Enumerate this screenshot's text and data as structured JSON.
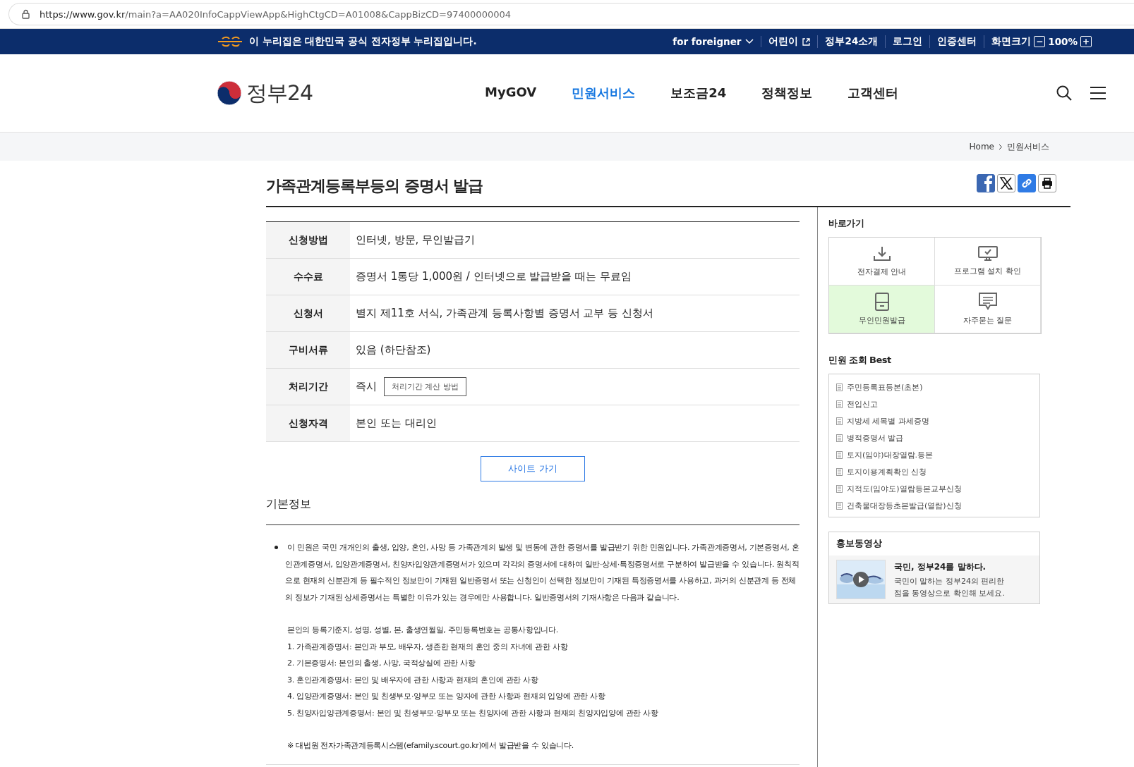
{
  "address_bar": {
    "url_host": "https://www.gov.kr",
    "url_path": "/main?a=AA020InfoCappViewApp&HighCtgCD=A01008&CappBizCD=97400000004"
  },
  "gov_banner": {
    "text": "이 누리집은 대한민국 공식 전자정부 누리집입니다.",
    "links": [
      {
        "label": "for foreigner",
        "kind": "dropdown"
      },
      {
        "label": "어린이",
        "kind": "external"
      },
      {
        "label": "정부24소개",
        "kind": "plain"
      },
      {
        "label": "로그인",
        "kind": "plain"
      },
      {
        "label": "인증센터",
        "kind": "plain"
      }
    ],
    "zoom": {
      "label": "화면크기",
      "minus": "−",
      "value": "100%",
      "plus": "+"
    }
  },
  "header": {
    "logo_text": "정부24",
    "nav": [
      {
        "label": "MyGOV",
        "selected": false
      },
      {
        "label": "민원서비스",
        "selected": true
      },
      {
        "label": "보조금24",
        "selected": false
      },
      {
        "label": "정책정보",
        "selected": false
      },
      {
        "label": "고객센터",
        "selected": false
      }
    ]
  },
  "breadcrumb": [
    "Home",
    "민원서비스"
  ],
  "page_title": "가족관계등록부등의 증명서 발급",
  "share_buttons": [
    {
      "kind": "facebook"
    },
    {
      "kind": "x"
    },
    {
      "kind": "link"
    },
    {
      "kind": "print"
    }
  ],
  "info_table": [
    {
      "label": "신청방법",
      "value": "인터넷, 방문, 무인발급기"
    },
    {
      "label": "수수료",
      "value": "증명서 1통당 1,000원 / 인터넷으로 발급받을 때는 무료임"
    },
    {
      "label": "신청서",
      "value": "별지 제11호 서식, 가족관계 등록사항별 증명서 교부 등 신청서"
    },
    {
      "label": "구비서류",
      "value": "있음 (하단참조)"
    },
    {
      "label": "처리기간",
      "value": "즉시",
      "button": "처리기간 계산 방법"
    },
    {
      "label": "신청자격",
      "value": "본인 또는 대리인"
    }
  ],
  "site_button": "사이트 가기",
  "basic_info": {
    "heading": "기본정보",
    "intro": "이 민원은 국민 개개인의 출생, 입양, 혼인, 사망 등 가족관계의 발생 및 변동에 관한 증명서를 발급받기 위한 민원입니다. 가족관계증명서, 기본증명서, 혼인관계증명서, 입양관계증명서, 친양자입양관계증명서가 있으며 각각의 증명서에 대하여 일반·상세·특정증명서로 구분하여 발급받을 수 있습니다. 원칙적으로 현재의 신분관계 등 필수적인 정보만이 기재된 일반증명서 또는 신청인이 선택한 정보만이 기재된 특정증명서를 사용하고, 과거의 신분관계 등 전체의 정보가 기재된 상세증명서는 특별한 이유가 있는 경우에만 사용합니다. 일반증명서의 기재사항은 다음과 같습니다.",
    "common": "본인의 등록기준지, 성명, 성별, 본, 출생연월일, 주민등록번호는 공통사항입니다.",
    "items": [
      "1. 가족관계증명서: 본인과 부모, 배우자, 생존한 현재의 혼인 중의 자녀에 관한 사항",
      "2. 기본증명서: 본인의 출생, 사망, 국적상실에 관한 사항",
      "3. 혼인관계증명서: 본인 및 배우자에 관한 사항과 현재의 혼인에 관한 사항",
      "4. 입양관계증명서: 본인 및 친생부모·양부모 또는 양자에 관한 사항과 현재의 입양에 관한 사항",
      "5. 친양자입양관계증명서: 본인 및 친생부모·양부모 또는 친양자에 관한 사항과 현재의 친양자입양에 관한 사항"
    ],
    "note": "※ 대법원 전자가족관계등록시스템(efamily.scourt.go.kr)에서 발급받을 수 있습니다."
  },
  "sidebar": {
    "shortcuts_title": "바로가기",
    "shortcuts": [
      {
        "label": "전자결제 안내",
        "kind": "download",
        "highlighted": false
      },
      {
        "label": "프로그램 설치 확인",
        "kind": "monitor",
        "highlighted": false
      },
      {
        "label": "무인민원발급",
        "kind": "kiosk",
        "highlighted": true
      },
      {
        "label": "자주묻는 질문",
        "kind": "chat",
        "highlighted": false
      }
    ],
    "best_title": "민원 조회 Best",
    "best": [
      "주민등록표등본(초본)",
      "전입신고",
      "지방세 세목별 과세증명",
      "병적증명서 발급",
      "토지(임야)대장열람.등본",
      "토지이용계획확인 신청",
      "지적도(임야도)열람등본교부신청",
      "건축물대장등초본발급(열람)신청"
    ],
    "video": {
      "title": "홍보동영상",
      "headline": "국민, 정부24를 말하다.",
      "description": "국민이 말하는 정부24의 편리한 점을 동영상으로 확인해 보세요."
    }
  }
}
